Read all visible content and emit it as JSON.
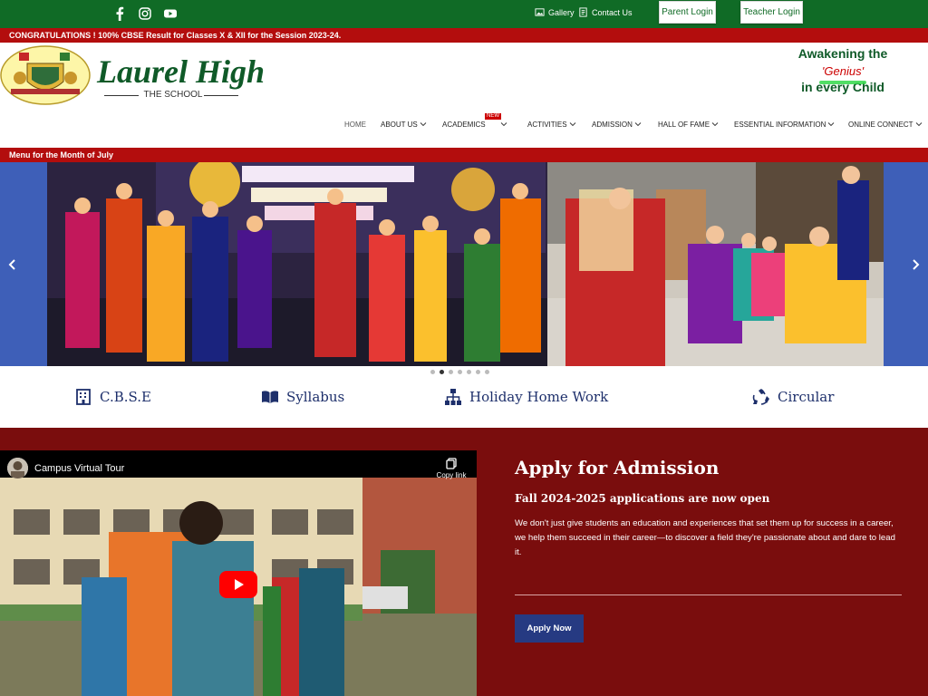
{
  "topbar": {
    "gallery_label": "Gallery",
    "contact_label": "Contact Us",
    "parent_login_label": "Parent Login",
    "teacher_login_label": "Teacher Login",
    "bg_color": "#106b26"
  },
  "announcement": {
    "text": "CONGRATULATIONS ! 100% CBSE Result for Classes X & XII for the Session 2023-24."
  },
  "brand": {
    "name": "Laurel High",
    "subtitle": "THE SCHOOL",
    "tagline_line1": "Awakening the",
    "tagline_genius": "'Genius'",
    "tagline_line3": "in every Child"
  },
  "nav": {
    "items": [
      {
        "label": "HOME"
      },
      {
        "label": "ABOUT US"
      },
      {
        "label": "ACADEMICS",
        "badge": "NEW"
      },
      {
        "label": "ACTIVITIES"
      },
      {
        "label": "ADMISSION"
      },
      {
        "label": "HALL OF FAME"
      },
      {
        "label": "ESSENTIAL INFORMATION"
      },
      {
        "label": "ONLINE CONNECT"
      }
    ]
  },
  "menu_strip": {
    "text": "Menu for the Month of July"
  },
  "quick_links": {
    "cbse": "C.B.S.E",
    "syllabus": "Syllabus",
    "holiday": "Holiday Home Work",
    "circular": "Circular"
  },
  "video": {
    "title": "Campus Virtual Tour",
    "copy_link": "Copy link"
  },
  "admission": {
    "title": "Apply for Admission",
    "subtitle": "Fall 2024-2025 applications are now open",
    "body": "We don't just give students an education and experiences that set them up for success in a career, we help them succeed in their career—to discover a field they're passionate about and dare to lead it.",
    "button_label": "Apply Now"
  },
  "colors": {
    "green": "#106b26",
    "red": "#b30d0d",
    "maroon": "#7a0d0d",
    "navy": "#1d2f6b",
    "button_blue": "#263a82"
  }
}
